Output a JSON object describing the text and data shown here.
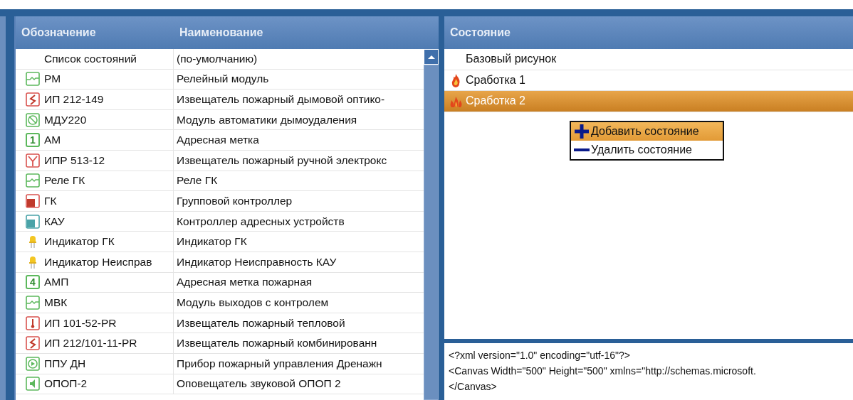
{
  "devices": {
    "columns": [
      "Обозначение",
      "Наименование"
    ],
    "rows": [
      {
        "kind": "none",
        "code": "Список состояний",
        "name": "(по-умолчанию)"
      },
      {
        "kind": "relay",
        "code": "РМ",
        "name": "Релейный модуль"
      },
      {
        "kind": "smoke",
        "code": "ИП 212-149",
        "name": "Извещатель пожарный дымовой оптико-"
      },
      {
        "kind": "mdu",
        "code": "МДУ220",
        "name": "Модуль автоматики дымоудаления"
      },
      {
        "kind": "number",
        "glyph": "1",
        "code": "АМ",
        "name": "Адресная метка"
      },
      {
        "kind": "manual",
        "code": "ИПР 513-12",
        "name": "Извещатель пожарный ручной электрокс"
      },
      {
        "kind": "relay",
        "code": "Реле ГК",
        "name": "Реле ГК"
      },
      {
        "kind": "gk",
        "code": "ГК",
        "name": "Групповой контроллер"
      },
      {
        "kind": "kau",
        "code": "КАУ",
        "name": "Контроллер адресных устройств"
      },
      {
        "kind": "led",
        "code": "Индикатор ГК",
        "name": "Индикатор ГК"
      },
      {
        "kind": "led",
        "code": "Индикатор Неисправ",
        "name": "Индикатор Неисправность КАУ"
      },
      {
        "kind": "number",
        "glyph": "4",
        "code": "АМП",
        "name": "Адресная метка пожарная"
      },
      {
        "kind": "relay",
        "code": "МВК",
        "name": "Модуль выходов с контролем"
      },
      {
        "kind": "heat",
        "code": "ИП 101-52-PR",
        "name": "Извещатель пожарный тепловой"
      },
      {
        "kind": "smoke",
        "code": "ИП 212/101-11-PR",
        "name": "Извещатель пожарный комбинированн"
      },
      {
        "kind": "ppu",
        "code": "ППУ ДН",
        "name": "Прибор пожарный управления Дренажн"
      },
      {
        "kind": "opop",
        "code": "ОПОП-2",
        "name": "Оповещатель звуковой ОПОП 2"
      }
    ]
  },
  "states": {
    "column": "Состояние",
    "rows": [
      {
        "kind": "plain",
        "label": "Базовый рисунок",
        "selected": false
      },
      {
        "kind": "flame",
        "label": "Сработка 1",
        "selected": false
      },
      {
        "kind": "flames",
        "label": "Сработка 2",
        "selected": true
      }
    ]
  },
  "context_menu": [
    {
      "kind": "add",
      "label": "Добавить состояние",
      "selected": true
    },
    {
      "kind": "remove",
      "label": "Удалить состояние",
      "selected": false
    }
  ],
  "xml_text": [
    "<?xml version=\"1.0\" encoding=\"utf-16\"?>",
    "<Canvas Width=\"500\" Height=\"500\" xmlns=\"http://schemas.microsoft.",
    "</Canvas>"
  ]
}
